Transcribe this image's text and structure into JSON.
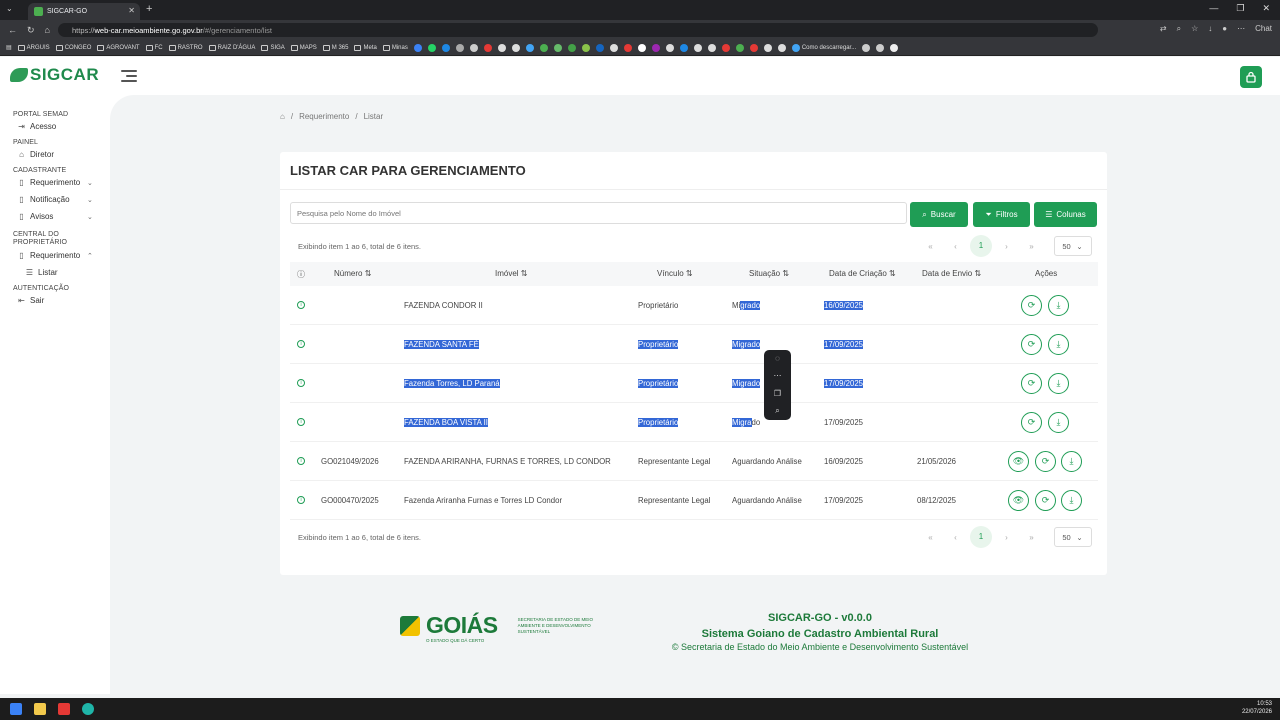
{
  "browser": {
    "tab_title": "SIGCAR-GO",
    "url_prefix": "https://",
    "url_domain": "web-car.meioambiente.go.gov.br",
    "url_path": "/#/gerenciamento/list",
    "chat_label": "Chat",
    "bookmarks": [
      "ARGUIS",
      "CONGEO",
      "AGROVANT",
      "FC",
      "RASTRO",
      "RAIZ D'ÁGUA",
      "SIGA",
      "MAPS",
      "M 365",
      "Meta",
      "Minas"
    ],
    "bookmark_last": "Como descarregar..."
  },
  "app": {
    "logo": "SIGCAR"
  },
  "sidebar": {
    "sec_portal": "PORTAL SEMAD",
    "acesso": "Acesso",
    "sec_painel": "PAINEL",
    "diretor": "Diretor",
    "sec_cadastrante": "CADASTRANTE",
    "requerimento": "Requerimento",
    "notificacao": "Notificação",
    "avisos": "Avisos",
    "sec_central": "CENTRAL DO PROPRIETÁRIO",
    "requerimento2": "Requerimento",
    "listar": "Listar",
    "sec_auth": "AUTENTICAÇÃO",
    "sair": "Sair"
  },
  "breadcrumb": {
    "item1": "Requerimento",
    "item2": "Listar"
  },
  "card": {
    "title": "LISTAR CAR PARA GERENCIAMENTO",
    "search_placeholder": "Pesquisa pelo Nome do Imóvel",
    "btn_buscar": "Buscar",
    "btn_filtros": "Filtros",
    "btn_colunas": "Colunas",
    "info_top": "Exibindo item 1 ao 6, total de 6 itens.",
    "info_bottom": "Exibindo item 1 ao 6, total de 6 itens.",
    "page": "1",
    "page_size": "50"
  },
  "table": {
    "headers": {
      "numero": "Número",
      "imovel": "Imóvel",
      "vinculo": "Vínculo",
      "situacao": "Situação",
      "criacao": "Data de Criação",
      "envio": "Data de Envio",
      "acoes": "Ações"
    },
    "rows": [
      {
        "numero": "",
        "imovel": "FAZENDA CONDOR II",
        "vinculo": "Proprietário",
        "situacao_a": "Mi",
        "situacao_b": "grado",
        "criacao": "16/09/2025",
        "envio": ""
      },
      {
        "numero": "",
        "imovel": "FAZENDA SANTA FÉ",
        "vinculo": "Proprietário",
        "situacao_a": "",
        "situacao_b": "Migrado",
        "criacao": "17/09/2025",
        "envio": ""
      },
      {
        "numero": "",
        "imovel": "Fazenda Torres, LD Paraná",
        "vinculo": "Proprietário",
        "situacao_a": "",
        "situacao_b": "Migrado",
        "criacao": "17/09/2025",
        "envio": ""
      },
      {
        "numero": "",
        "imovel": "FAZENDA BOA VISTA II",
        "vinculo": "Proprietário",
        "situacao_a": "Migra",
        "situacao_b": "do",
        "criacao": "17/09/2025",
        "envio": ""
      },
      {
        "numero": "GO021049/2026",
        "imovel": "FAZENDA ARIRANHA, FURNAS E TORRES, LD CONDOR",
        "vinculo": "Representante Legal",
        "situacao": "Aguardando Análise",
        "criacao": "16/09/2025",
        "envio": "21/05/2026"
      },
      {
        "numero": "GO000470/2025",
        "imovel": "Fazenda Ariranha Furnas e Torres LD Condor",
        "vinculo": "Representante Legal",
        "situacao": "Aguardando Análise",
        "criacao": "17/09/2025",
        "envio": "08/12/2025"
      }
    ]
  },
  "footer": {
    "goias": "GOIÁS",
    "goias_tag": "O ESTADO QUE DÁ CERTO",
    "secretaria": "SECRETARIA DE ESTADO DE MEIO AMBIENTE E DESENVOLVIMENTO SUSTENTÁVEL",
    "version": "SIGCAR-GO - v0.0.0",
    "system": "Sistema Goiano de Cadastro Ambiental Rural",
    "copyright": "© Secretaria de Estado do Meio Ambiente e Desenvolvimento Sustentável"
  },
  "taskbar": {
    "time": "10:53",
    "date": "22/07/2026"
  },
  "colors": {
    "accent": "#1f9d55",
    "selection": "#3367d6"
  }
}
